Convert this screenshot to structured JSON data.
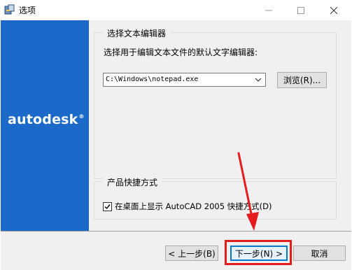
{
  "window": {
    "title": "选项"
  },
  "branding": {
    "logo_text": "autodesk",
    "mark": "®"
  },
  "editor_group": {
    "legend": "选择文本编辑器",
    "description": "选择用于编辑文本文件的默认文字编辑器:",
    "editor_path": "C:\\Windows\\notepad.exe",
    "browse_label": "浏览(R)..."
  },
  "shortcut_group": {
    "legend": "产品快捷方式",
    "checkbox_label": "在桌面上显示 AutoCAD 2005 快捷方式(D)",
    "checked": true
  },
  "footer": {
    "back_label": "< 上一步(B)",
    "next_label": "下一步(N) >",
    "cancel_label": "取消"
  },
  "colors": {
    "brand_blue": "#1b6ac9",
    "highlight_red": "#e51c1c",
    "focus_blue": "#0078d7"
  }
}
